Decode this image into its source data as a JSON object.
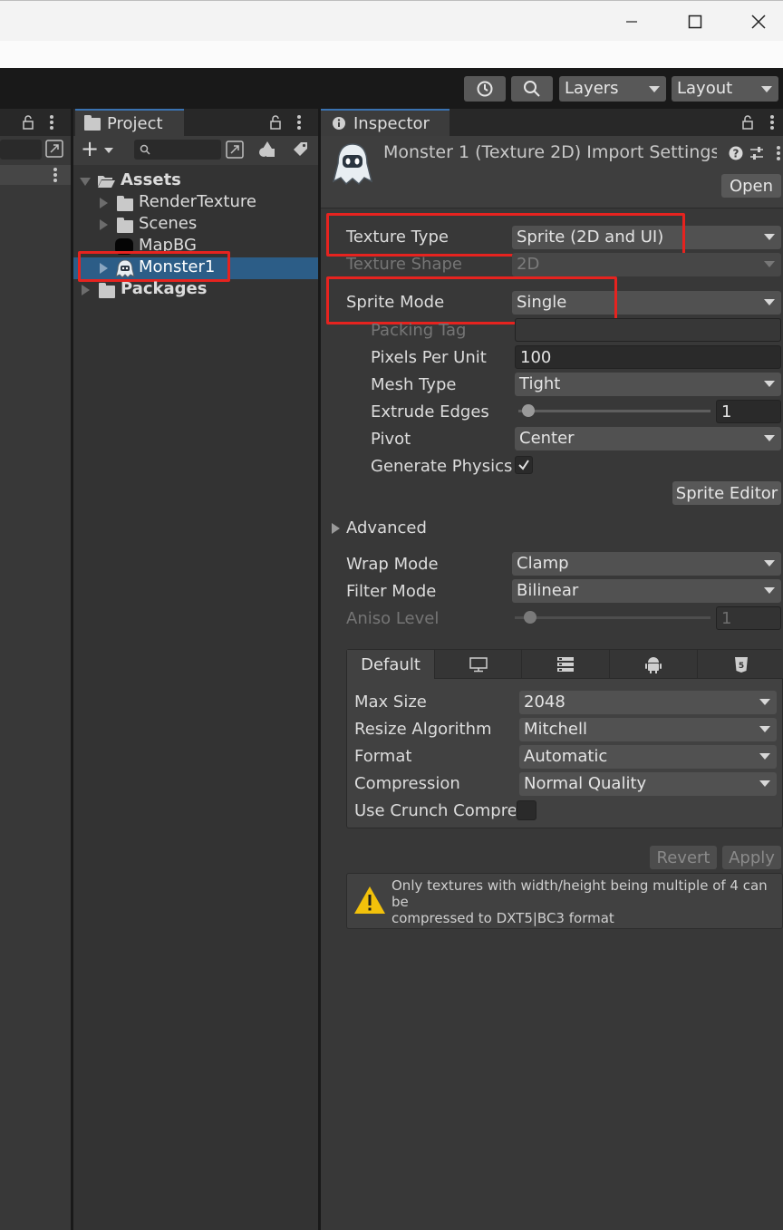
{
  "toolbar": {
    "history_icon": "history-icon",
    "search_icon": "search-icon",
    "layers_label": "Layers",
    "layout_label": "Layout"
  },
  "project": {
    "tab_label": "Project",
    "add_label": "+",
    "tree": {
      "assets": "Assets",
      "render_texture": "RenderTexture",
      "scenes": "Scenes",
      "map_bg": "MapBG",
      "monster1": "Monster1",
      "packages": "Packages"
    }
  },
  "inspector": {
    "tab_label": "Inspector",
    "header_title": "Monster 1 (Texture 2D) Import Settings",
    "open_button": "Open",
    "rows": {
      "texture_type": {
        "label": "Texture Type",
        "value": "Sprite (2D and UI)"
      },
      "texture_shape": {
        "label": "Texture Shape",
        "value": "2D"
      },
      "sprite_mode": {
        "label": "Sprite Mode",
        "value": "Single"
      },
      "packing_tag": {
        "label": "Packing Tag",
        "value": ""
      },
      "pixels_per_unit": {
        "label": "Pixels Per Unit",
        "value": "100"
      },
      "mesh_type": {
        "label": "Mesh Type",
        "value": "Tight"
      },
      "extrude_edges": {
        "label": "Extrude Edges",
        "value": "1"
      },
      "pivot": {
        "label": "Pivot",
        "value": "Center"
      },
      "generate_physics": {
        "label": "Generate Physics",
        "checked": true
      }
    },
    "sprite_editor_button": "Sprite Editor",
    "advanced_label": "Advanced",
    "wrap_mode": {
      "label": "Wrap Mode",
      "value": "Clamp"
    },
    "filter_mode": {
      "label": "Filter Mode",
      "value": "Bilinear"
    },
    "aniso_level": {
      "label": "Aniso Level",
      "value": "1"
    },
    "platform": {
      "default_tab": "Default",
      "icons": [
        "monitor-icon",
        "server-icon",
        "android-icon",
        "html5-icon"
      ],
      "max_size": {
        "label": "Max Size",
        "value": "2048"
      },
      "resize_algorithm": {
        "label": "Resize Algorithm",
        "value": "Mitchell"
      },
      "format": {
        "label": "Format",
        "value": "Automatic"
      },
      "compression": {
        "label": "Compression",
        "value": "Normal Quality"
      },
      "use_crunch": {
        "label": "Use Crunch Compression",
        "checked": false
      }
    },
    "revert_button": "Revert",
    "apply_button": "Apply",
    "warning_text_line1": "Only textures with width/height being multiple of 4 can be",
    "warning_text_line2": "compressed to DXT5|BC3 format"
  },
  "colors": {
    "highlight": "#e6231f",
    "selection": "#2c5d87",
    "background": "#383838"
  }
}
